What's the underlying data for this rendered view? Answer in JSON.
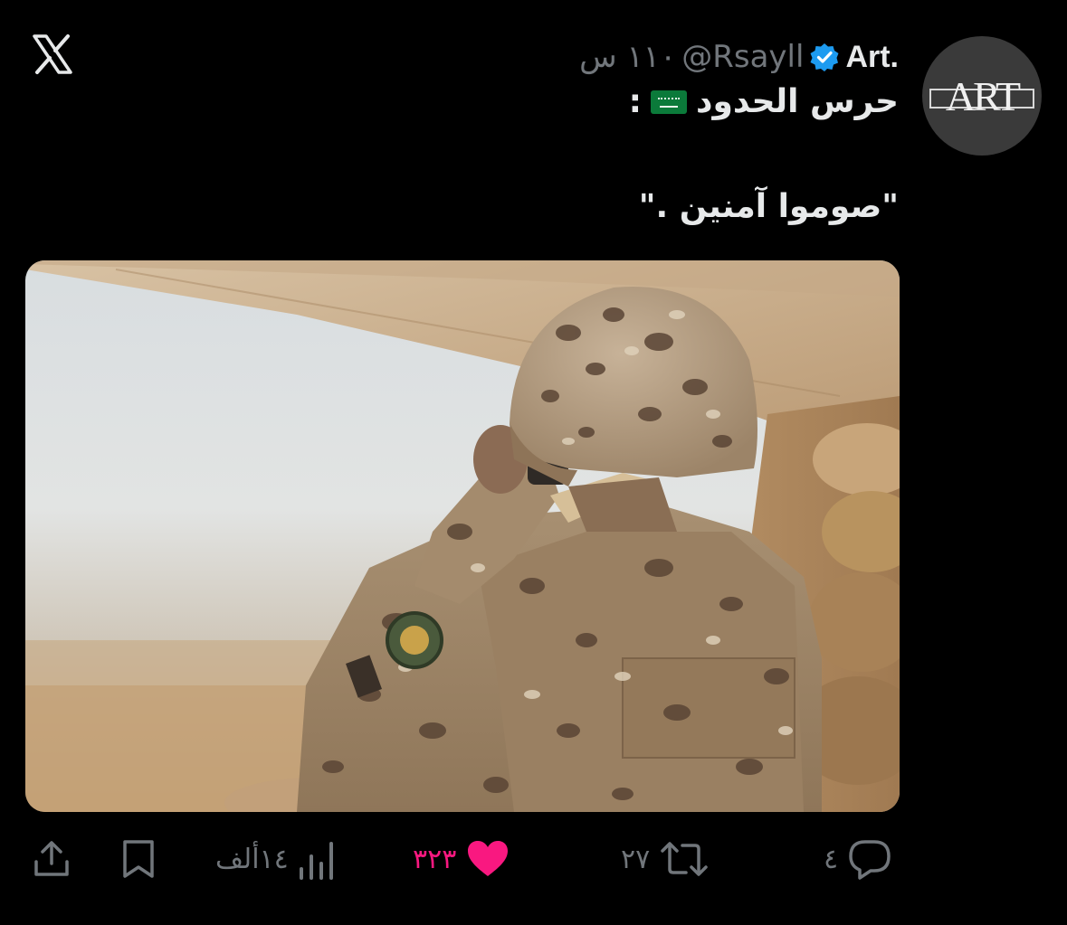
{
  "app": {
    "logo": "x-logo"
  },
  "post": {
    "display_name": "Art.",
    "handle": "@Rsayll",
    "time": "١١٠ س",
    "line1": "حرس الحدود",
    "line1_suffix": ":",
    "line2": "\"صوموا آمنين .\"",
    "avatar_text": "ART",
    "verified_color": "#1d9bf0",
    "flag_icon": "saudi-flag-emoji"
  },
  "actions": {
    "reply_count": "٤",
    "repost_count": "٢٧",
    "like_count": "٣٢٣",
    "views_count": "١٤ألف",
    "like_color": "#f91880",
    "muted_color": "#71767b"
  },
  "icons": [
    "share-icon",
    "bookmark-icon",
    "views-icon",
    "heart-icon",
    "repost-icon",
    "reply-icon",
    "verified-icon"
  ]
}
